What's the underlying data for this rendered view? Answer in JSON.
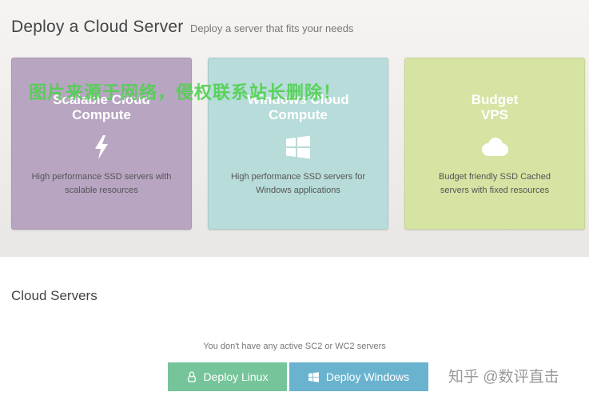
{
  "header": {
    "title": "Deploy a Cloud Server",
    "subtitle": "Deploy a server that fits your needs"
  },
  "cards": [
    {
      "title": "Scalable Cloud\nCompute",
      "icon": "lightning-bolt-icon",
      "description": "High performance SSD servers with\nscalable resources",
      "color": "#b8a5c2"
    },
    {
      "title": "Windows Cloud\nCompute",
      "icon": "windows-logo-icon",
      "description": "High performance SSD servers for\nWindows applications",
      "color": "#b7dcd9"
    },
    {
      "title": "Budget\nVPS",
      "icon": "cloud-icon",
      "description": "Budget friendly SSD Cached\nservers with fixed resources",
      "color": "#d5e4a3"
    }
  ],
  "watermark": "图片来源于网络，侵权联系站长删除！",
  "cloud_servers": {
    "title": "Cloud Servers",
    "empty_message": "You don't have any active SC2 or WC2 servers",
    "deploy_linux_label": "Deploy Linux",
    "deploy_windows_label": "Deploy Windows",
    "linux_button_color": "#76c59a",
    "windows_button_color": "#6ab3cf"
  },
  "corner_brand": "知乎 @数评直击"
}
